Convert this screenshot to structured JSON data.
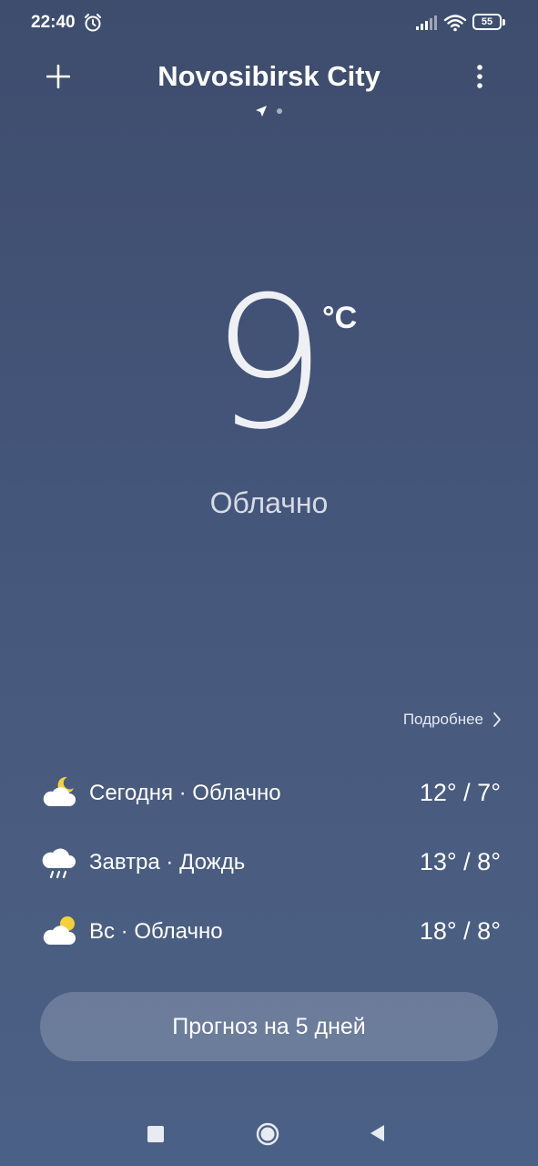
{
  "status_bar": {
    "time": "22:40",
    "battery_level": "55",
    "icons": [
      "alarm-icon",
      "signal-icon",
      "wifi-icon",
      "battery-icon"
    ]
  },
  "header": {
    "city": "Novosibirsk City",
    "page_count": 2,
    "current_page": 1,
    "icons": [
      "plus-icon",
      "more-vertical-icon",
      "location-arrow-icon"
    ]
  },
  "current": {
    "temperature": "9",
    "unit": "°C",
    "condition": "Облачно"
  },
  "details_link": {
    "label": "Подробнее"
  },
  "forecast": [
    {
      "label": "Сегодня · Облачно",
      "range": "12° / 7°",
      "icon": "partly-cloudy-icon"
    },
    {
      "label": "Завтра · Дождь",
      "range": "13° / 8°",
      "icon": "rain-icon"
    },
    {
      "label": "Вс · Облачно",
      "range": "18° / 8°",
      "icon": "partly-cloudy-icon"
    }
  ],
  "forecast_button": {
    "label": "Прогноз на 5 дней"
  },
  "colors": {
    "background_top": "#3e4d6d",
    "background_bottom": "#4b6086",
    "sun": "#f4d13a",
    "text": "#ffffff"
  }
}
